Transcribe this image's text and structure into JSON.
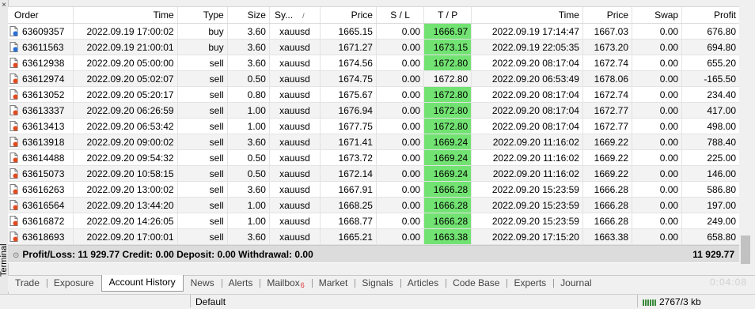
{
  "panel": {
    "side_label": "Terminal",
    "close_glyph": "×"
  },
  "columns": {
    "order": "Order",
    "time": "Time",
    "type": "Type",
    "size": "Size",
    "symbol": "Sy...",
    "price": "Price",
    "sl": "S / L",
    "tp": "T / P",
    "close_time": "Time",
    "close_price": "Price",
    "swap": "Swap",
    "profit": "Profit",
    "sort_glyph": "/"
  },
  "rows": [
    {
      "order": "63609357",
      "time": "2022.09.19 17:00:02",
      "type": "buy",
      "size": "3.60",
      "symbol": "xauusd",
      "price": "1665.15",
      "sl": "0.00",
      "tp": "1666.97",
      "tp_hit": true,
      "close_time": "2022.09.19 17:14:47",
      "close_price": "1667.03",
      "swap": "0.00",
      "profit": "676.80"
    },
    {
      "order": "63611563",
      "time": "2022.09.19 21:00:01",
      "type": "buy",
      "size": "3.60",
      "symbol": "xauusd",
      "price": "1671.27",
      "sl": "0.00",
      "tp": "1673.15",
      "tp_hit": true,
      "close_time": "2022.09.19 22:05:35",
      "close_price": "1673.20",
      "swap": "0.00",
      "profit": "694.80"
    },
    {
      "order": "63612938",
      "time": "2022.09.20 05:00:00",
      "type": "sell",
      "size": "3.60",
      "symbol": "xauusd",
      "price": "1674.56",
      "sl": "0.00",
      "tp": "1672.80",
      "tp_hit": true,
      "close_time": "2022.09.20 08:17:04",
      "close_price": "1672.74",
      "swap": "0.00",
      "profit": "655.20"
    },
    {
      "order": "63612974",
      "time": "2022.09.20 05:02:07",
      "type": "sell",
      "size": "0.50",
      "symbol": "xauusd",
      "price": "1674.75",
      "sl": "0.00",
      "tp": "1672.80",
      "tp_hit": false,
      "close_time": "2022.09.20 06:53:49",
      "close_price": "1678.06",
      "swap": "0.00",
      "profit": "-165.50"
    },
    {
      "order": "63613052",
      "time": "2022.09.20 05:20:17",
      "type": "sell",
      "size": "0.80",
      "symbol": "xauusd",
      "price": "1675.67",
      "sl": "0.00",
      "tp": "1672.80",
      "tp_hit": true,
      "close_time": "2022.09.20 08:17:04",
      "close_price": "1672.74",
      "swap": "0.00",
      "profit": "234.40"
    },
    {
      "order": "63613337",
      "time": "2022.09.20 06:26:59",
      "type": "sell",
      "size": "1.00",
      "symbol": "xauusd",
      "price": "1676.94",
      "sl": "0.00",
      "tp": "1672.80",
      "tp_hit": true,
      "close_time": "2022.09.20 08:17:04",
      "close_price": "1672.77",
      "swap": "0.00",
      "profit": "417.00"
    },
    {
      "order": "63613413",
      "time": "2022.09.20 06:53:42",
      "type": "sell",
      "size": "1.00",
      "symbol": "xauusd",
      "price": "1677.75",
      "sl": "0.00",
      "tp": "1672.80",
      "tp_hit": true,
      "close_time": "2022.09.20 08:17:04",
      "close_price": "1672.77",
      "swap": "0.00",
      "profit": "498.00"
    },
    {
      "order": "63613918",
      "time": "2022.09.20 09:00:02",
      "type": "sell",
      "size": "3.60",
      "symbol": "xauusd",
      "price": "1671.41",
      "sl": "0.00",
      "tp": "1669.24",
      "tp_hit": true,
      "close_time": "2022.09.20 11:16:02",
      "close_price": "1669.22",
      "swap": "0.00",
      "profit": "788.40"
    },
    {
      "order": "63614488",
      "time": "2022.09.20 09:54:32",
      "type": "sell",
      "size": "0.50",
      "symbol": "xauusd",
      "price": "1673.72",
      "sl": "0.00",
      "tp": "1669.24",
      "tp_hit": true,
      "close_time": "2022.09.20 11:16:02",
      "close_price": "1669.22",
      "swap": "0.00",
      "profit": "225.00"
    },
    {
      "order": "63615073",
      "time": "2022.09.20 10:58:15",
      "type": "sell",
      "size": "0.50",
      "symbol": "xauusd",
      "price": "1672.14",
      "sl": "0.00",
      "tp": "1669.24",
      "tp_hit": true,
      "close_time": "2022.09.20 11:16:02",
      "close_price": "1669.22",
      "swap": "0.00",
      "profit": "146.00"
    },
    {
      "order": "63616263",
      "time": "2022.09.20 13:00:02",
      "type": "sell",
      "size": "3.60",
      "symbol": "xauusd",
      "price": "1667.91",
      "sl": "0.00",
      "tp": "1666.28",
      "tp_hit": true,
      "close_time": "2022.09.20 15:23:59",
      "close_price": "1666.28",
      "swap": "0.00",
      "profit": "586.80"
    },
    {
      "order": "63616564",
      "time": "2022.09.20 13:44:20",
      "type": "sell",
      "size": "1.00",
      "symbol": "xauusd",
      "price": "1668.25",
      "sl": "0.00",
      "tp": "1666.28",
      "tp_hit": true,
      "close_time": "2022.09.20 15:23:59",
      "close_price": "1666.28",
      "swap": "0.00",
      "profit": "197.00"
    },
    {
      "order": "63616872",
      "time": "2022.09.20 14:26:05",
      "type": "sell",
      "size": "1.00",
      "symbol": "xauusd",
      "price": "1668.77",
      "sl": "0.00",
      "tp": "1666.28",
      "tp_hit": true,
      "close_time": "2022.09.20 15:23:59",
      "close_price": "1666.28",
      "swap": "0.00",
      "profit": "249.00"
    },
    {
      "order": "63618693",
      "time": "2022.09.20 17:00:01",
      "type": "sell",
      "size": "3.60",
      "symbol": "xauusd",
      "price": "1665.21",
      "sl": "0.00",
      "tp": "1663.38",
      "tp_hit": true,
      "close_time": "2022.09.20 17:15:20",
      "close_price": "1663.38",
      "swap": "0.00",
      "profit": "658.80"
    }
  ],
  "summary": {
    "circle_glyph": "⊙",
    "text": "Profit/Loss: 11 929.77  Credit: 0.00  Deposit: 0.00  Withdrawal: 0.00",
    "total": "11 929.77"
  },
  "tabs": [
    {
      "label": "Trade",
      "active": false
    },
    {
      "label": "Exposure",
      "active": false
    },
    {
      "label": "Account History",
      "active": true
    },
    {
      "label": "News",
      "active": false
    },
    {
      "label": "Alerts",
      "active": false
    },
    {
      "label": "Mailbox",
      "active": false,
      "badge": "6"
    },
    {
      "label": "Market",
      "active": false
    },
    {
      "label": "Signals",
      "active": false
    },
    {
      "label": "Articles",
      "active": false
    },
    {
      "label": "Code Base",
      "active": false
    },
    {
      "label": "Experts",
      "active": false
    },
    {
      "label": "Journal",
      "active": false
    }
  ],
  "clock": "0:04:08",
  "status": {
    "profile": "Default",
    "traffic": "2767/3 kb"
  },
  "colors": {
    "tp_hit": "#72e372",
    "buy_icon": "#2a6fd6",
    "sell_icon": "#e04b20"
  }
}
